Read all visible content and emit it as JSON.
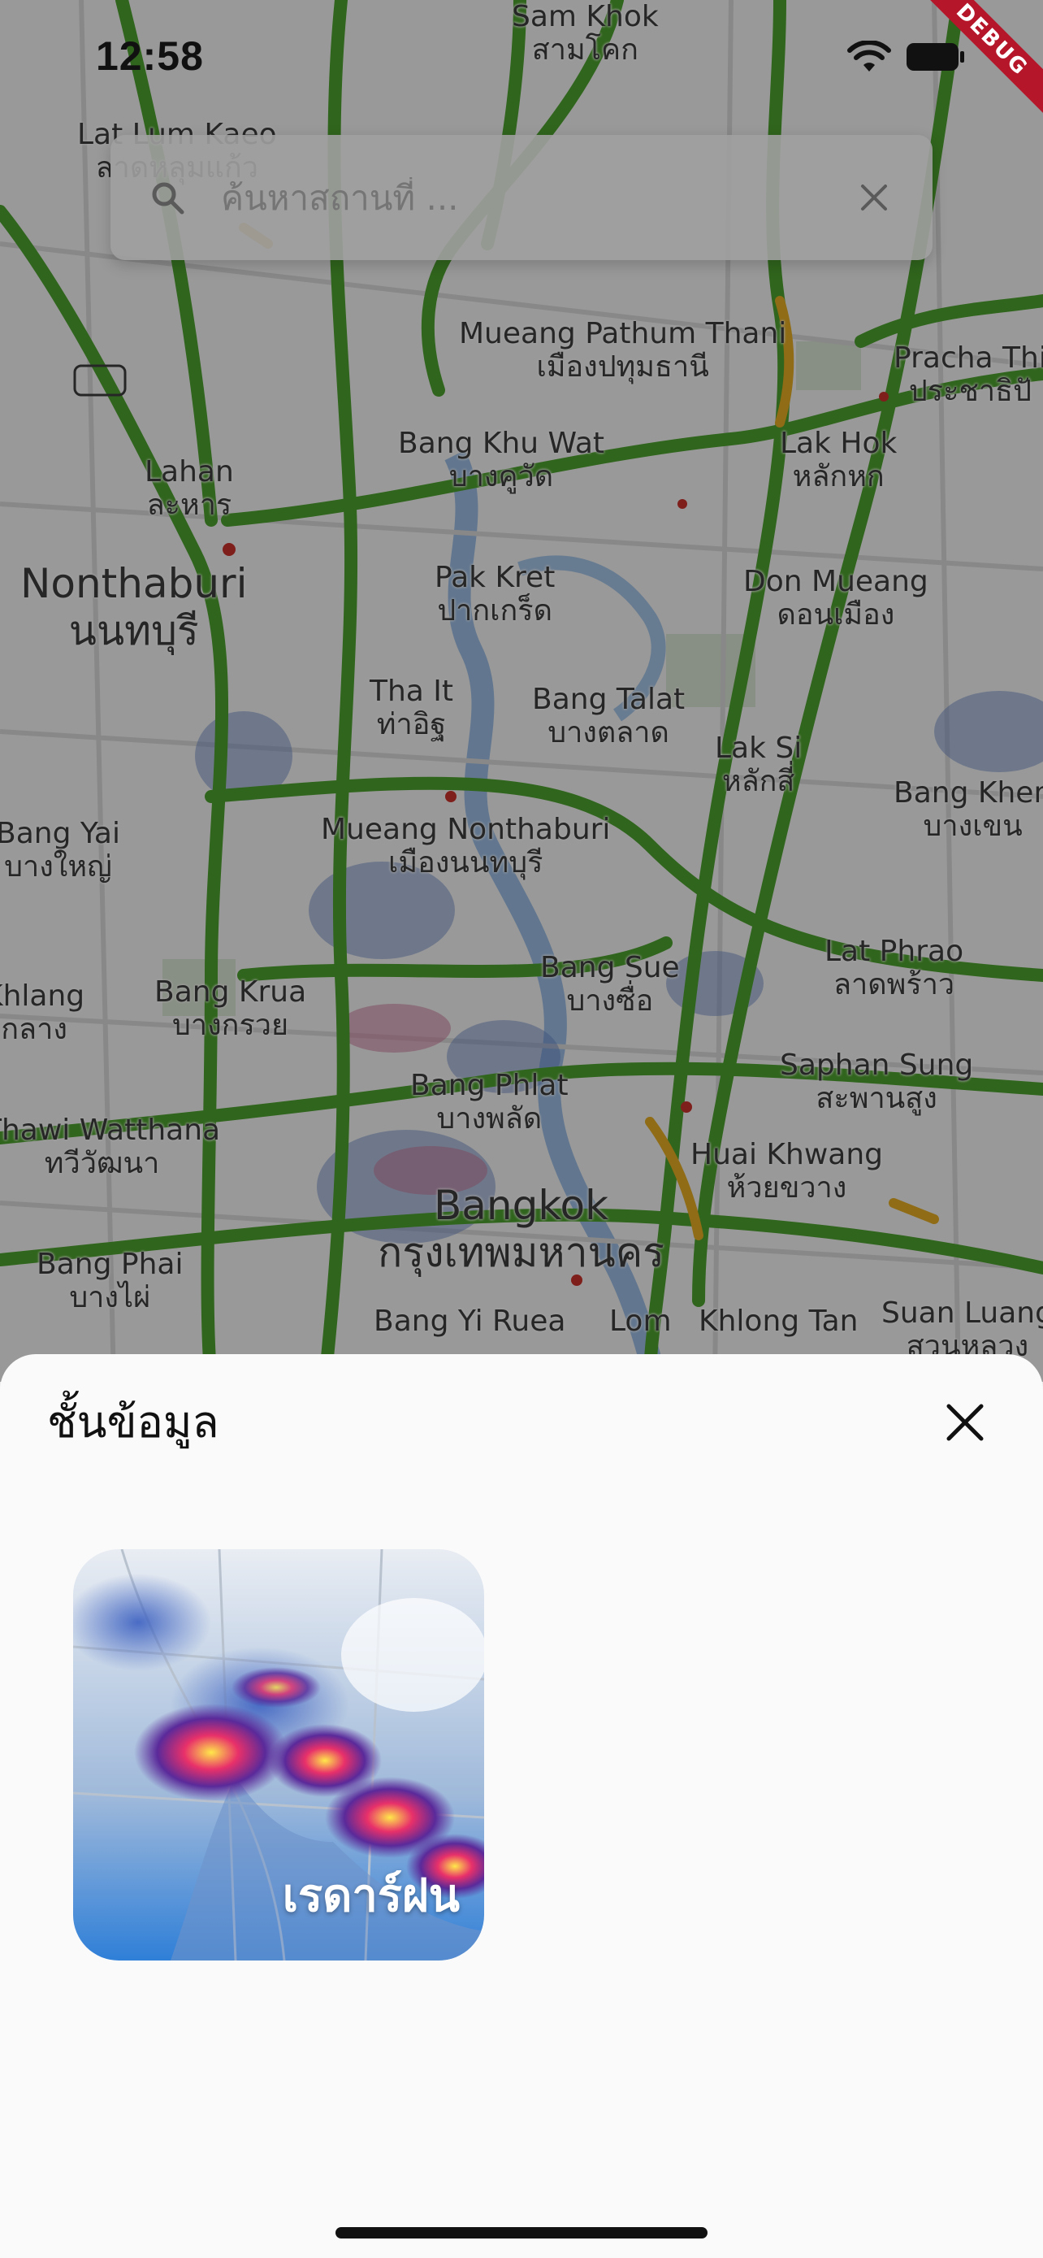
{
  "status_bar": {
    "time": "12:58"
  },
  "debug_banner": "DEBUG",
  "search": {
    "placeholder": "ค้นหาสถานที่ ..."
  },
  "map": {
    "places": [
      {
        "en": "Sam Khok",
        "th": "สามโคก"
      },
      {
        "en": "Lat Lum Kaeo",
        "th": "ลาดหลุมแก้ว"
      },
      {
        "en": "Mueang Pathum Thani",
        "th": "เมืองปทุมธานี"
      },
      {
        "en": "Pracha Thi",
        "th": "ประชาธิปั"
      },
      {
        "en": "Bang Khu Wat",
        "th": "บางคูวัด"
      },
      {
        "en": "Lahan",
        "th": "ละหาร"
      },
      {
        "en": "Lak Hok",
        "th": "หลักหก"
      },
      {
        "en": "Nonthaburi",
        "th": "นนทบุรี"
      },
      {
        "en": "Pak Kret",
        "th": "ปากเกร็ด"
      },
      {
        "en": "Don Mueang",
        "th": "ดอนเมือง"
      },
      {
        "en": "Tha It",
        "th": "ท่าอิฐ"
      },
      {
        "en": "Bang Talat",
        "th": "บางตลาด"
      },
      {
        "en": "Lak Si",
        "th": "หลักสี่"
      },
      {
        "en": "Bang Yai",
        "th": "บางใหญ่"
      },
      {
        "en": "Mueang Nonthaburi",
        "th": "เมืองนนทบุรี"
      },
      {
        "en": "Bang Khen",
        "th": "บางเขน"
      },
      {
        "en": "Bang Sue",
        "th": "บางซื่อ"
      },
      {
        "en": "Lat Phrao",
        "th": "ลาดพร้าว"
      },
      {
        "en": "Bang Krua",
        "th": "บางกรวย"
      },
      {
        "en": "Bang Phlat",
        "th": "บางพลัด"
      },
      {
        "en": "Saphan Sung",
        "th": "สะพานสูง"
      },
      {
        "en": "Thawi Watthana",
        "th": "ทวีวัฒนา"
      },
      {
        "en": "Huai Khwang",
        "th": "ห้วยขวาง"
      },
      {
        "en": "Bangkok",
        "th": "กรุงเทพมหานคร"
      },
      {
        "en": "Bang Phai",
        "th": "บางไผ่"
      },
      {
        "en": "Bang Yi Ruea",
        "th": ""
      },
      {
        "en": "Lom",
        "th": ""
      },
      {
        "en": "Khlong Tan",
        "th": ""
      },
      {
        "en": "Suan Luang",
        "th": "สวนหลวง"
      },
      {
        "en": "Khlang",
        "th": "กลาง"
      }
    ]
  },
  "sheet": {
    "title": "ชั้นข้อมูล",
    "layers": [
      {
        "label": "เรดาร์ฝน",
        "icon": "rain-radar"
      }
    ]
  },
  "colors": {
    "road_green": "#4a9a2c",
    "road_yellow": "#d9a520",
    "water": "#7fa8d6",
    "sheet_bg": "#fafafa"
  }
}
